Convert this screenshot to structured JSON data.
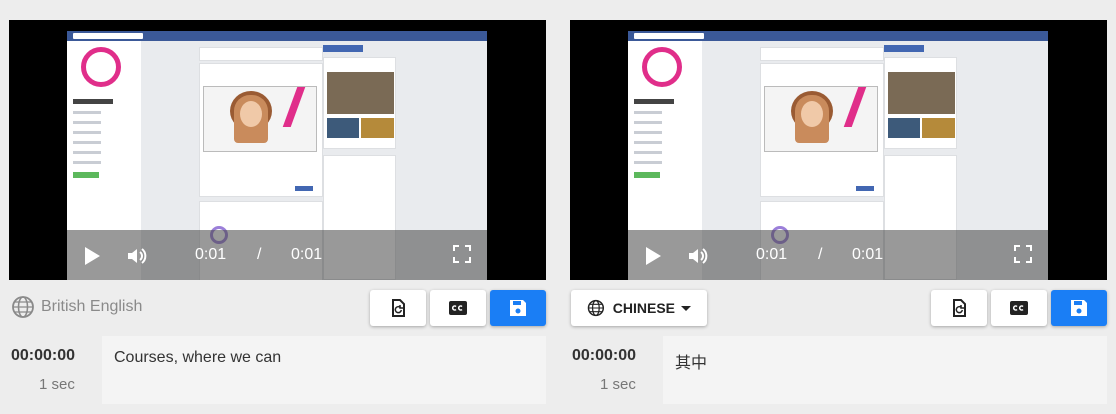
{
  "left": {
    "player": {
      "current_time": "0:01",
      "separator": "/",
      "duration": "0:01"
    },
    "language_label": "British English",
    "caption": {
      "timestamp": "00:00:00",
      "duration": "1 sec",
      "text": "Courses, where we can"
    }
  },
  "right": {
    "player": {
      "current_time": "0:01",
      "separator": "/",
      "duration": "0:01"
    },
    "language_label": "CHINESE",
    "caption": {
      "timestamp": "00:00:00",
      "duration": "1 sec",
      "text": "其中"
    }
  },
  "toolbar_icons": [
    "restore-icon",
    "closed-caption-icon",
    "save-icon"
  ],
  "colors": {
    "accent": "#1a7ef5",
    "brand_pink": "#e02e8a",
    "facebook_blue": "#3b5998"
  }
}
